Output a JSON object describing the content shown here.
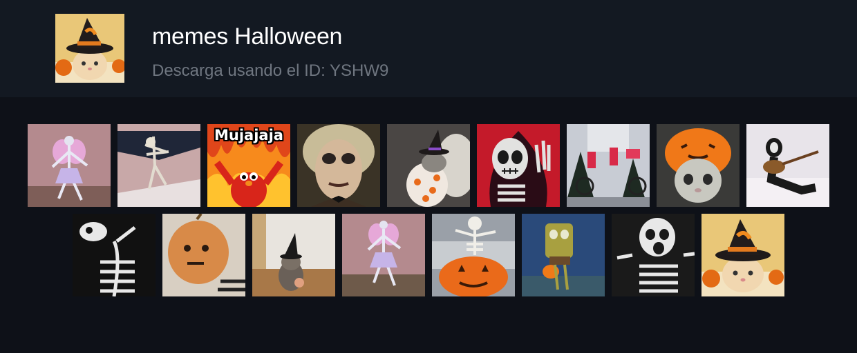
{
  "pack": {
    "title": "memes Halloween",
    "subtitle": "Descarga usando el ID: YSHW9"
  },
  "stickers": [
    {
      "name": "fairy-skeleton",
      "caption": ""
    },
    {
      "name": "hanging-skeleton",
      "caption": ""
    },
    {
      "name": "elmo-fire",
      "caption": "Mujajaja"
    },
    {
      "name": "beetlejuice",
      "caption": ""
    },
    {
      "name": "cat-witch-costume",
      "caption": ""
    },
    {
      "name": "skeleton-rock-hand",
      "caption": ""
    },
    {
      "name": "skeletons-bicycle",
      "caption": ""
    },
    {
      "name": "crying-cat-pumpkin-hat",
      "caption": ""
    },
    {
      "name": "skeleton-guitar",
      "caption": ""
    },
    {
      "name": "dancing-skeleton",
      "caption": ""
    },
    {
      "name": "pumpkin-head",
      "caption": ""
    },
    {
      "name": "kitten-witch-hat",
      "caption": ""
    },
    {
      "name": "fairy-skeleton-2",
      "caption": ""
    },
    {
      "name": "skeleton-in-pumpkin",
      "caption": ""
    },
    {
      "name": "spongebob-pumpkin",
      "caption": ""
    },
    {
      "name": "screaming-skeleton",
      "caption": ""
    },
    {
      "name": "cat-witch-hat",
      "caption": ""
    }
  ]
}
